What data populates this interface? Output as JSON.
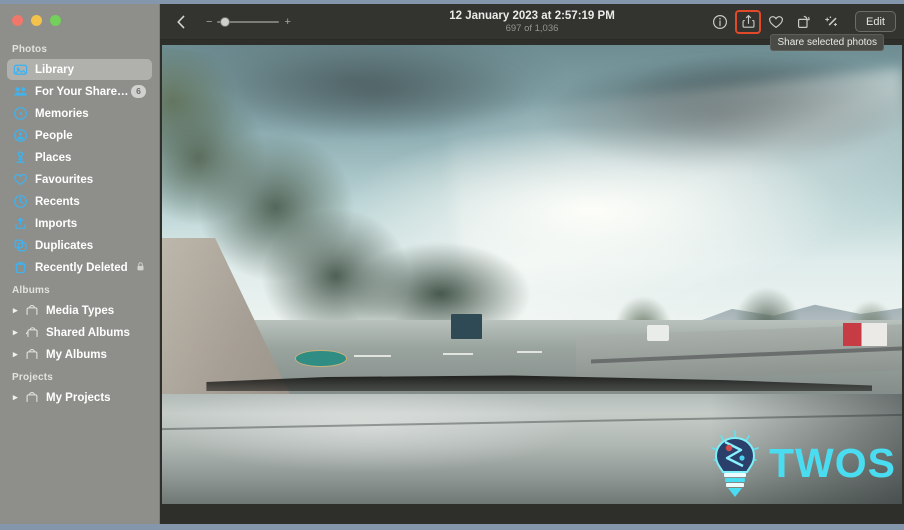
{
  "window": {
    "traffic_lights": [
      "close",
      "minimize",
      "zoom"
    ]
  },
  "sidebar": {
    "sections": [
      {
        "title": "Photos",
        "items": [
          {
            "label": "Library",
            "icon": "photos-library-icon",
            "selected": true
          },
          {
            "label": "For Your Shared Li…",
            "icon": "shared-library-icon",
            "badge": "6"
          },
          {
            "label": "Memories",
            "icon": "memories-icon"
          },
          {
            "label": "People",
            "icon": "people-icon"
          },
          {
            "label": "Places",
            "icon": "places-pin-icon"
          },
          {
            "label": "Favourites",
            "icon": "heart-icon"
          },
          {
            "label": "Recents",
            "icon": "clock-icon"
          },
          {
            "label": "Imports",
            "icon": "import-arrow-icon"
          },
          {
            "label": "Duplicates",
            "icon": "duplicates-icon"
          },
          {
            "label": "Recently Deleted",
            "icon": "trash-icon",
            "lock": true
          }
        ]
      },
      {
        "title": "Albums",
        "items": [
          {
            "label": "Media Types",
            "icon": "folder-icon",
            "disclosure": true
          },
          {
            "label": "Shared Albums",
            "icon": "shared-folder-icon",
            "disclosure": true
          },
          {
            "label": "My Albums",
            "icon": "folder-icon",
            "disclosure": true
          }
        ]
      },
      {
        "title": "Projects",
        "items": [
          {
            "label": "My Projects",
            "icon": "folder-icon",
            "disclosure": true
          }
        ]
      }
    ]
  },
  "toolbar": {
    "back_icon": "chevron-left-icon",
    "zoom_minus": "−",
    "zoom_plus": "+",
    "title": "12 January 2023 at 2:57:19 PM",
    "subtitle": "697 of 1,036",
    "actions": [
      {
        "name": "info-button",
        "icon": "info-circle-icon",
        "highlighted": false
      },
      {
        "name": "share-button",
        "icon": "share-up-arrow-icon",
        "highlighted": true
      },
      {
        "name": "favourite-button",
        "icon": "heart-icon",
        "highlighted": false
      },
      {
        "name": "rotate-button",
        "icon": "rotate-icon",
        "highlighted": false
      },
      {
        "name": "enhance-button",
        "icon": "magic-wand-icon",
        "highlighted": false
      }
    ],
    "edit_label": "Edit",
    "tooltip": "Share selected photos"
  },
  "photo": {
    "description": "Driving view through a car windshield on a highway with trees on the left and cloudy sky"
  },
  "watermark": {
    "text": "TWOS",
    "logo": "lightbulb-icon"
  },
  "colors": {
    "highlight": "#e04a28",
    "accent_blue": "#4ab7ef",
    "watermark_cyan": "#4adcf0",
    "sidebar_bg": "#8e8e8a",
    "toolbar_bg": "#333330",
    "content_bg": "#2e2e2a",
    "page_border": "#8496ab"
  }
}
